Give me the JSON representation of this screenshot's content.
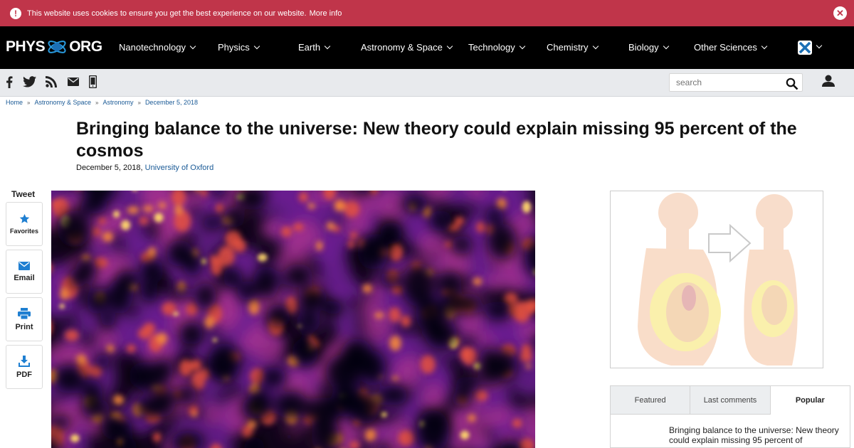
{
  "cookie": {
    "text": "This website uses cookies to ensure you get the best experience on our website.",
    "link": "More info",
    "close": "✕"
  },
  "nav": {
    "logo_left": "PHYS",
    "logo_right": "ORG",
    "items": [
      "Nanotechnology",
      "Physics",
      "Earth",
      "Astronomy & Space",
      "Technology",
      "Chemistry",
      "Biology",
      "Other Sciences"
    ]
  },
  "search": {
    "placeholder": "search"
  },
  "breadcrumb": [
    "Home",
    "Astronomy & Space",
    "Astronomy",
    "December 5, 2018"
  ],
  "article": {
    "title": "Bringing balance to the universe: New theory could explain missing 95 percent of the cosmos",
    "date": "December 5, 2018,",
    "source": "University of Oxford"
  },
  "share": {
    "tweet": "Tweet",
    "favorites": "Favorites",
    "email": "Email",
    "print": "Print",
    "pdf": "PDF"
  },
  "tabs": {
    "items": [
      "Featured",
      "Last comments",
      "Popular"
    ],
    "active": "Popular",
    "popular_item": "Bringing balance to the universe: New theory could explain missing 95 percent of"
  },
  "colors": {
    "cookie_bar": "#c0354a",
    "nav_bg": "#000000",
    "link": "#1a5a96",
    "accent_blue": "#1f7fd1"
  }
}
